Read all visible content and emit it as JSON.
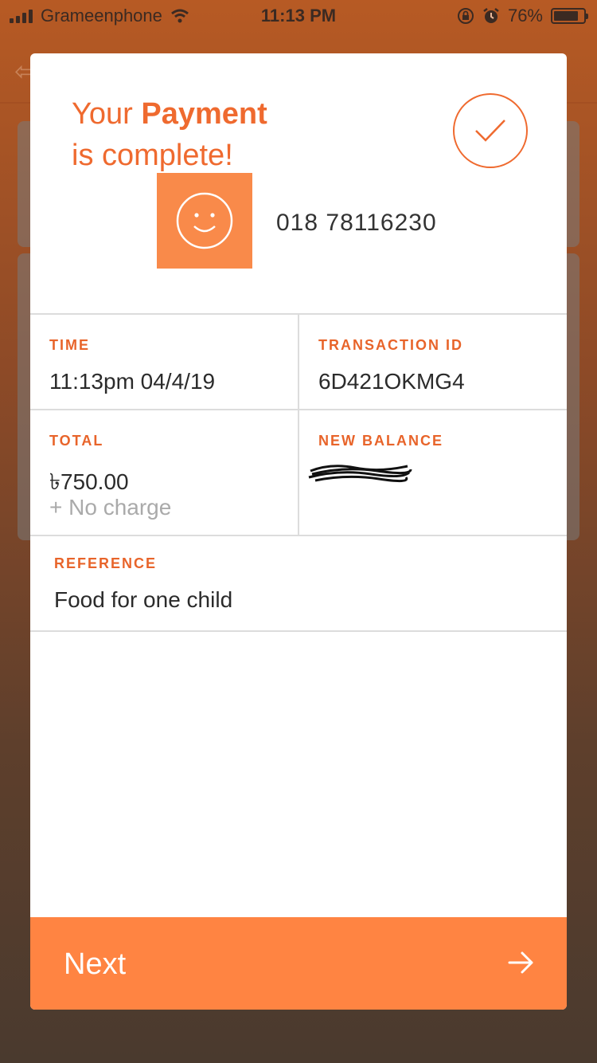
{
  "status_bar": {
    "carrier": "Grameenphone",
    "time": "11:13 PM",
    "battery_percent": "76%",
    "battery_level": 0.76
  },
  "modal": {
    "title_prefix": "Your ",
    "title_bold": "Payment",
    "title_line2": "is complete!",
    "recipient_number": "018 78116230",
    "details": {
      "time_label": "TIME",
      "time_value": "11:13pm 04/4/19",
      "transaction_label": "TRANSACTION ID",
      "transaction_value": "6D421OKMG4",
      "total_label": "TOTAL",
      "total_value": "৳750.00",
      "total_charge": "+ No charge",
      "balance_label": "NEW BALANCE",
      "reference_label": "REFERENCE",
      "reference_value": "Food for one child"
    },
    "next_label": "Next"
  },
  "colors": {
    "accent": "#ef6a2f",
    "button": "#ff8442",
    "avatar": "#f98a4a"
  },
  "icons": [
    "signal-icon",
    "wifi-icon",
    "orientation-lock-icon",
    "alarm-icon",
    "battery-icon",
    "checkmark-icon",
    "smiley-icon",
    "arrow-right-icon"
  ]
}
